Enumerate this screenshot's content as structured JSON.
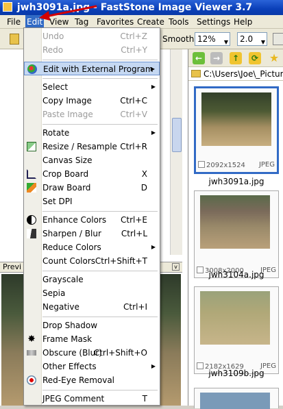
{
  "window": {
    "title": "jwh3091a.jpg  -  FastStone Image Viewer 3.7"
  },
  "menubar": [
    "File",
    "Edit",
    "View",
    "Tag",
    "Favorites",
    "Create",
    "Tools",
    "Settings",
    "Help"
  ],
  "toolbar": {
    "smooth_label": "Smooth",
    "zoom": "12%",
    "scale": "2.0"
  },
  "right": {
    "path": "C:\\Users\\Joe\\_Pictures"
  },
  "preview": {
    "label": "Previ"
  },
  "thumbnails": [
    {
      "dims": "2092x1524",
      "format": "JPEG",
      "name": "jwh3091a.jpg"
    },
    {
      "dims": "3008x2000",
      "format": "JPEG",
      "name": "jwh3104a.jpg"
    },
    {
      "dims": "2182x1629",
      "format": "JPEG",
      "name": "jwh3109b.jpg"
    }
  ],
  "menu": [
    {
      "label": "Undo",
      "shortcut": "Ctrl+Z",
      "disabled": true
    },
    {
      "label": "Redo",
      "shortcut": "Ctrl+Y",
      "disabled": true
    },
    {
      "label": "Edit with External Program",
      "submenu": true,
      "highlight": true,
      "icon": "external-program-icon"
    },
    {
      "label": "Select",
      "submenu": true
    },
    {
      "label": "Copy Image",
      "shortcut": "Ctrl+C"
    },
    {
      "label": "Paste Image",
      "shortcut": "Ctrl+V",
      "disabled": true
    },
    {
      "label": "Rotate",
      "submenu": true
    },
    {
      "label": "Resize / Resample",
      "shortcut": "Ctrl+R",
      "icon": "resize-icon"
    },
    {
      "label": "Canvas Size"
    },
    {
      "label": "Crop Board",
      "shortcut": "X",
      "icon": "crop-icon"
    },
    {
      "label": "Draw Board",
      "shortcut": "D",
      "icon": "draw-icon"
    },
    {
      "label": "Set DPI"
    },
    {
      "label": "Enhance Colors",
      "shortcut": "Ctrl+E",
      "icon": "enhance-icon"
    },
    {
      "label": "Sharpen / Blur",
      "shortcut": "Ctrl+L",
      "icon": "sharpen-icon"
    },
    {
      "label": "Reduce Colors",
      "submenu": true
    },
    {
      "label": "Count Colors",
      "shortcut": "Ctrl+Shift+T"
    },
    {
      "label": "Grayscale"
    },
    {
      "label": "Sepia"
    },
    {
      "label": "Negative",
      "shortcut": "Ctrl+I"
    },
    {
      "label": "Drop Shadow"
    },
    {
      "label": "Frame Mask",
      "icon": "frame-mask-icon"
    },
    {
      "label": "Obscure (Blur)",
      "shortcut": "Ctrl+Shift+O",
      "icon": "obscure-icon"
    },
    {
      "label": "Other Effects",
      "submenu": true
    },
    {
      "label": "Red-Eye Removal",
      "icon": "red-eye-icon"
    },
    {
      "label": "JPEG Comment",
      "shortcut": "T"
    }
  ],
  "colors": {
    "title_bar": "#0a3fb8",
    "menu_highlight": "#c5d8f2",
    "selection": "#316ac5",
    "annotation_arrow": "#d40000"
  }
}
